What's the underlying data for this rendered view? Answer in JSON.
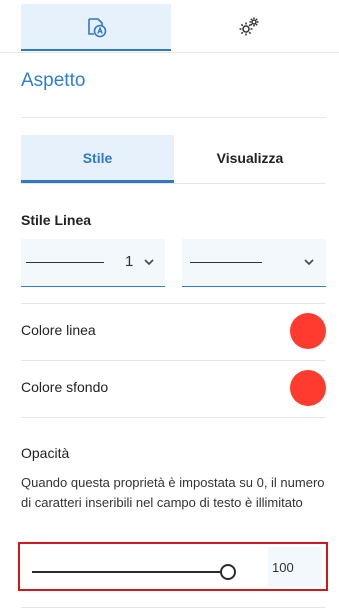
{
  "top_tabs": [
    {
      "icon": "text-style-icon",
      "active": true
    },
    {
      "icon": "gears-icon",
      "active": false
    }
  ],
  "section": {
    "title": "Aspetto"
  },
  "sub_tabs": [
    {
      "label": "Stile",
      "active": true
    },
    {
      "label": "Visualizza",
      "active": false
    }
  ],
  "line_style": {
    "label": "Stile Linea",
    "thickness_value": "1",
    "pattern_value": "solid"
  },
  "line_color": {
    "label": "Colore linea",
    "color": "#ff3b2f"
  },
  "background_color": {
    "label": "Colore sfondo",
    "color": "#ff3b2f"
  },
  "opacity": {
    "label": "Opacità",
    "description": "Quando questa proprietà è impostata su 0, il numero di caratteri inseribili nel campo di testo è illimitato",
    "value": "100"
  },
  "colors": {
    "accent": "#2f7fd0",
    "active_bg": "#e7f1fb",
    "highlight_border": "#d0191f"
  }
}
